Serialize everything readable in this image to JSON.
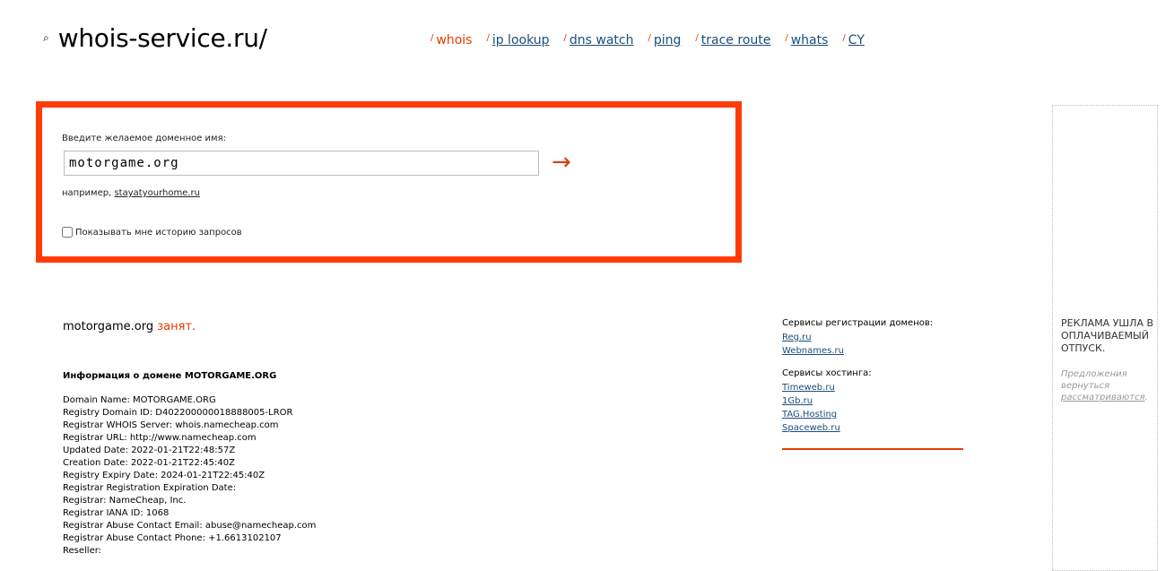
{
  "header": {
    "logo_text": "whois-service.ru/",
    "logo_icon": "search-icon",
    "nav": [
      {
        "label": "whois",
        "active": true
      },
      {
        "label": "ip lookup",
        "active": false
      },
      {
        "label": "dns watch",
        "active": false
      },
      {
        "label": "ping",
        "active": false
      },
      {
        "label": "trace route",
        "active": false
      },
      {
        "label": "whats",
        "active": false
      },
      {
        "label": "CY",
        "active": false
      }
    ]
  },
  "search": {
    "label": "Введите желаемое доменное имя:",
    "value": "motorgame.org",
    "submit_icon": "→",
    "example_prefix": "например,",
    "example_link": "stayatyourhome.ru",
    "history_label": "Показывать мне историю запросов",
    "history_checked": false
  },
  "result": {
    "domain": "motorgame.org",
    "status": "занят.",
    "info_title": "Информация о домене MOTORGAME.ORG",
    "whois_lines": [
      "Domain Name: MOTORGAME.ORG",
      "Registry Domain ID: D402200000018888005-LROR",
      "Registrar WHOIS Server: whois.namecheap.com",
      "Registrar URL: http://www.namecheap.com",
      "Updated Date: 2022-01-21T22:48:57Z",
      "Creation Date: 2022-01-21T22:45:40Z",
      "Registry Expiry Date: 2024-01-21T22:45:40Z",
      "Registrar Registration Expiration Date:",
      "Registrar: NameCheap, Inc.",
      "Registrar IANA ID: 1068",
      "Registrar Abuse Contact Email: abuse@namecheap.com",
      "Registrar Abuse Contact Phone: +1.6613102107",
      "Reseller:"
    ]
  },
  "services": {
    "registration_title": "Сервисы регистрации доменов:",
    "registration_links": [
      "Reg.ru",
      "Webnames.ru"
    ],
    "hosting_title": "Сервисы хостинга:",
    "hosting_links": [
      "Timeweb.ru",
      "1Gb.ru",
      "TAG.Hosting",
      "Spaceweb.ru"
    ]
  },
  "ad": {
    "title": "Реклама ушла в оплачиваемый отпуск.",
    "note_prefix": "Предложения вернуться",
    "note_link": "рассматриваются",
    "note_suffix": "."
  },
  "colors": {
    "accent": "#ff3b0a",
    "link": "#1a4e7a"
  }
}
